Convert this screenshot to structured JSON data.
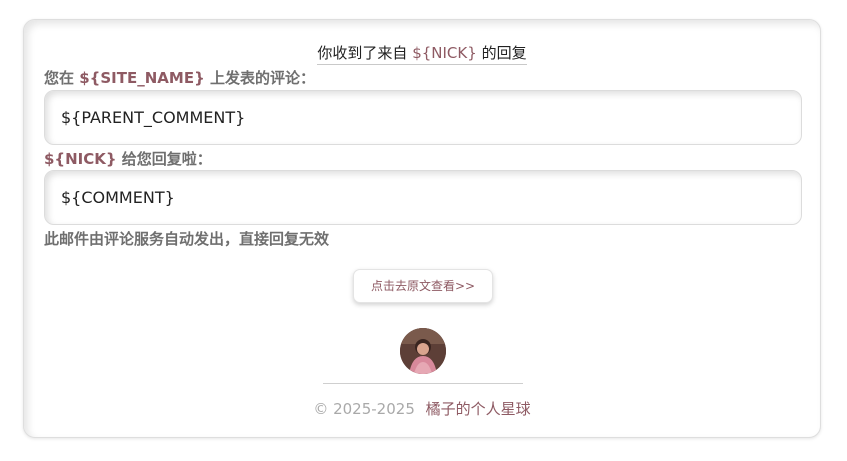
{
  "header": {
    "title_prefix": "你收到了来自",
    "nick": "${NICK}",
    "title_suffix": "的回复"
  },
  "parent_section": {
    "label_prefix": "您在",
    "site_name": "${SITE_NAME}",
    "label_suffix": "上发表的评论：",
    "comment": "${PARENT_COMMENT}"
  },
  "reply_section": {
    "nick": "${NICK}",
    "label_suffix": "给您回复啦：",
    "comment": "${COMMENT}"
  },
  "notice": "此邮件由评论服务自动发出，直接回复无效",
  "view_button": {
    "label": "点击去原文查看>>"
  },
  "footer": {
    "copyright": "© 2025-2025",
    "site_link": "橘子的个人星球"
  },
  "colors": {
    "accent": "#8e5a63",
    "label_gray": "#6f6f6f",
    "footer_gray": "#a9a9a9"
  }
}
